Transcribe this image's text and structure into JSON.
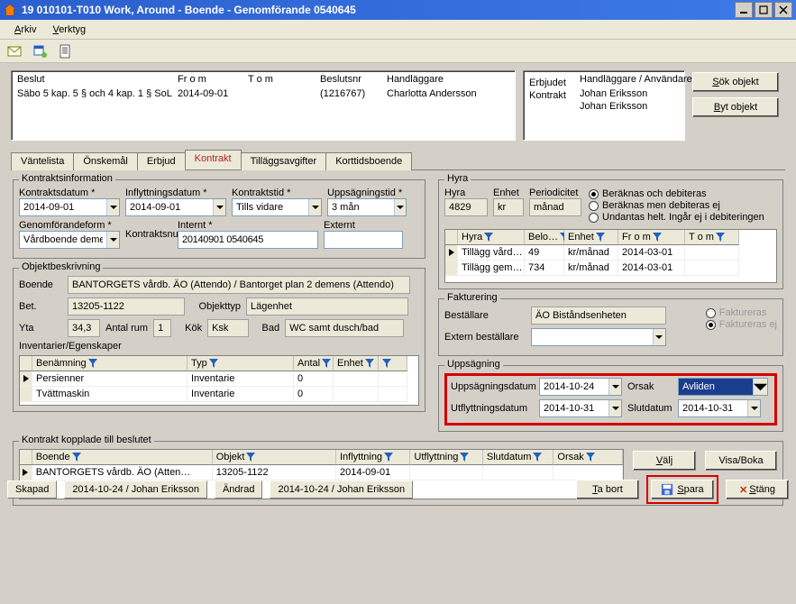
{
  "window": {
    "title": "19 010101-T010   Work, Around   -   Boende - Genomförande   0540645"
  },
  "menu": {
    "file": "Arkiv",
    "tools": "Verktyg"
  },
  "top_buttons": {
    "search": "Sök objekt",
    "change": "Byt objekt"
  },
  "info_left": {
    "h1": "Beslut",
    "h2": "Fr o m",
    "h3": "T o m",
    "h4": "Beslutsnr",
    "h5": "Handläggare",
    "v1": "Säbo 5 kap. 5 § och 4 kap. 1 § SoL",
    "v2": "2014-09-01",
    "v3": "",
    "v4": "(1216767)",
    "v5": "Charlotta Andersson"
  },
  "info_right": {
    "h1": "",
    "h2": "Handläggare / Användare",
    "r1a": "Erbjudet",
    "r1b": "Johan Eriksson",
    "r2a": "Kontrakt",
    "r2b": "Johan Eriksson"
  },
  "tabs": {
    "t1": "Väntelista",
    "t2": "Önskemål",
    "t3": "Erbjud",
    "t4": "Kontrakt",
    "t5": "Tilläggsavgifter",
    "t6": "Korttidsboende"
  },
  "kontraktinfo": {
    "legend": "Kontraktsinformation",
    "l_kd": "Kontraktsdatum *",
    "v_kd": "2014-09-01",
    "l_if": "Inflyttningsdatum *",
    "v_if": "2014-09-01",
    "l_kt": "Kontraktstid *",
    "v_kt": "Tills vidare",
    "l_up": "Uppsägningstid *",
    "v_up": "3 mån",
    "l_gf": "Genomförandeform *",
    "v_gf": "Vårdboende deme",
    "l_kn": "Kontraktsnummer:",
    "l_int": "Internt *",
    "v_int": "20140901 0540645",
    "l_ext": "Externt",
    "v_ext": ""
  },
  "objekt": {
    "legend": "Objektbeskrivning",
    "l_bo": "Boende",
    "v_bo": "BANTORGETS vårdb. ÄO (Attendo) / Bantorget plan 2 demens (Attendo)",
    "l_bet": "Bet.",
    "v_bet": "13205-1122",
    "l_ot": "Objekttyp",
    "v_ot": "Lägenhet",
    "l_yta": "Yta",
    "v_yta": "34,3",
    "l_rum": "Antal rum",
    "v_rum": "1",
    "l_kok": "Kök",
    "v_kok": "Ksk",
    "l_bad": "Bad",
    "v_bad": "WC samt dusch/bad",
    "l_inv": "Inventarier/Egenskaper"
  },
  "inv_table": {
    "h1": "Benämning",
    "h2": "Typ",
    "h3": "Antal",
    "h4": "Enhet",
    "r1a": "Persienner",
    "r1b": "Inventarie",
    "r1c": "0",
    "r1d": "",
    "r2a": "Tvättmaskin",
    "r2b": "Inventarie",
    "r2c": "0",
    "r2d": ""
  },
  "hyra": {
    "legend": "Hyra",
    "l_hy": "Hyra",
    "v_hy": "4829",
    "l_en": "Enhet",
    "v_en": "kr",
    "l_pe": "Periodicitet",
    "v_pe": "månad",
    "rb1": "Beräknas och debiteras",
    "rb2": "Beräknas men debiteras ej",
    "rb3": "Undantas helt. Ingår ej i debiteringen"
  },
  "hyra_table": {
    "h1": "Hyra",
    "h2": "Belo…",
    "h3": "Enhet",
    "h4": "Fr o m",
    "h5": "T o m",
    "r1a": "Tillägg vård…",
    "r1b": "49",
    "r1c": "kr/månad",
    "r1d": "2014-03-01",
    "r1e": "",
    "r2a": "Tillägg gem…",
    "r2b": "734",
    "r2c": "kr/månad",
    "r2d": "2014-03-01",
    "r2e": ""
  },
  "fakt": {
    "legend": "Fakturering",
    "l_be": "Beställare",
    "v_be": "ÄO Biståndsenheten",
    "l_ex": "Extern beställare",
    "v_ex": "",
    "rb1": "Faktureras",
    "rb2": "Faktureras ej"
  },
  "upps": {
    "legend": "Uppsägning",
    "l_ud": "Uppsägningsdatum",
    "v_ud": "2014-10-24",
    "l_uf": "Utflyttningsdatum",
    "v_uf": "2014-10-31",
    "l_or": "Orsak",
    "v_or": "Avliden",
    "l_sl": "Slutdatum",
    "v_sl": "2014-10-31"
  },
  "kb": {
    "legend": "Kontrakt kopplade till beslutet",
    "h1": "Boende",
    "h2": "Objekt",
    "h3": "Inflyttning",
    "h4": "Utflyttning",
    "h5": "Slutdatum",
    "h6": "Orsak",
    "r1a": "BANTORGETS vårdb. ÄO (Atten…",
    "r1b": "13205-1122",
    "r1c": "2014-09-01",
    "r1d": "",
    "r1e": "",
    "r1f": "",
    "b1": "Välj",
    "b2": "Visa/Boka"
  },
  "footer": {
    "s1l": "Skapad",
    "s1v": "2014-10-24 / Johan Eriksson",
    "s2l": "Ändrad",
    "s2v": "2014-10-24 / Johan Eriksson",
    "b_del": "Ta bort",
    "b_save": "Spara",
    "b_close": "Stäng"
  }
}
